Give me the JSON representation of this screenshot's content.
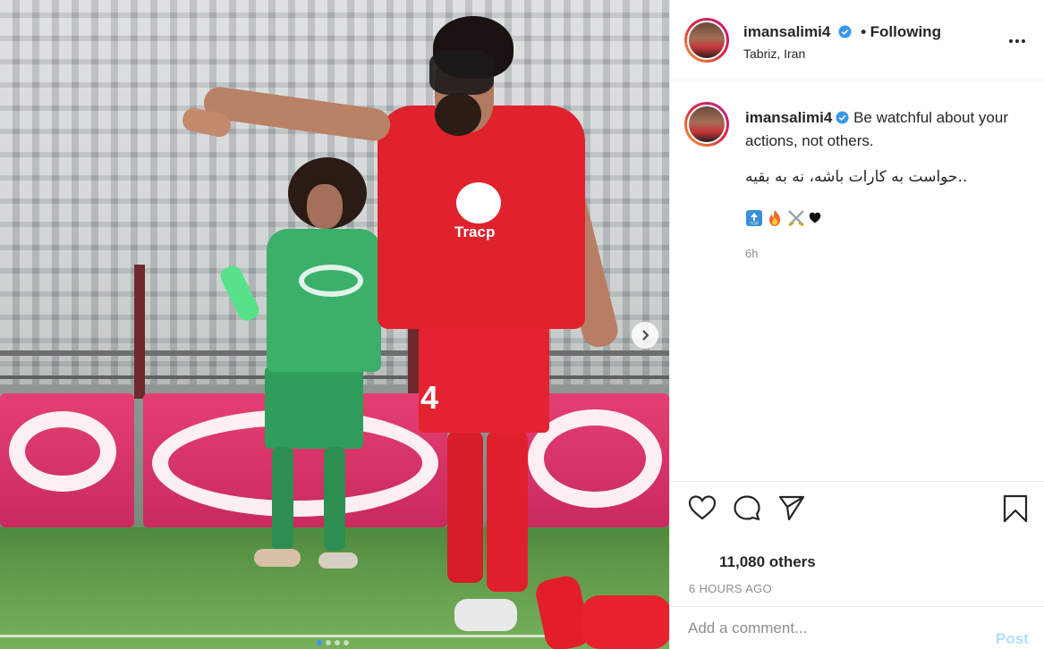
{
  "photo": {
    "jersey_text": "Tracp",
    "shorts_number": "4",
    "carousel_dots": 4,
    "active_dot": 1
  },
  "header": {
    "username": "imansalimi4",
    "verified": true,
    "separator": "•",
    "follow_status": "Following",
    "location": "Tabriz, Iran"
  },
  "caption": {
    "username": "imansalimi4",
    "text": "Be watchful about your actions, not others.",
    "persian_text": "..حواست به کارات باشه، نه به بقیه",
    "emojis": [
      "top-icon",
      "fire-icon",
      "crossed-swords-icon",
      "black-heart-icon"
    ],
    "time": "6h"
  },
  "actions": {
    "likes": "11,080 others",
    "timestamp": "6 HOURS AGO"
  },
  "comment": {
    "placeholder": "Add a comment...",
    "post_label": "Post"
  },
  "colors": {
    "accent": "#0095f6",
    "post_disabled": "#b2dffc",
    "muted": "#8e8e8e"
  }
}
